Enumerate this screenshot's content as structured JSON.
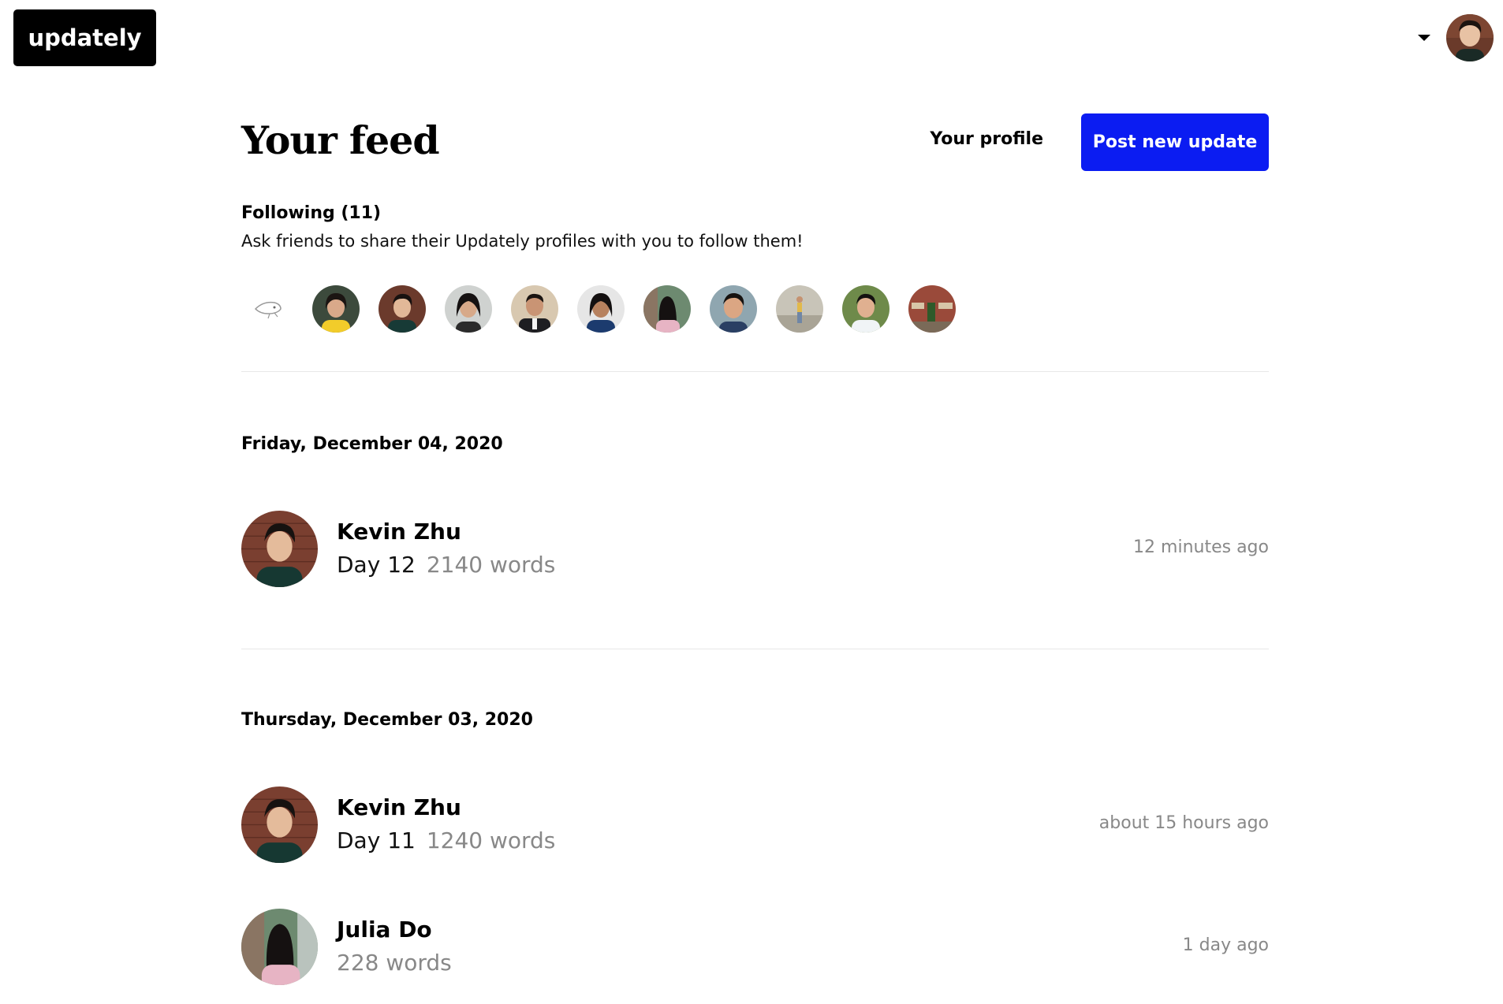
{
  "brand": {
    "logo_text": "updately"
  },
  "account": {
    "menu_icon": "caret-down-icon"
  },
  "header": {
    "title": "Your feed",
    "profile_link": "Your profile",
    "post_button": "Post new update"
  },
  "following": {
    "label": "Following (11)",
    "hint": "Ask friends to share their Updately profiles with you to follow them!",
    "avatars": [
      {
        "name": "sketch-avatar"
      },
      {
        "name": "avatar-yellow-shirt"
      },
      {
        "name": "avatar-brick-wall"
      },
      {
        "name": "avatar-dark-hair"
      },
      {
        "name": "avatar-suit"
      },
      {
        "name": "avatar-scarf"
      },
      {
        "name": "avatar-julia"
      },
      {
        "name": "avatar-smiling"
      },
      {
        "name": "avatar-street"
      },
      {
        "name": "avatar-park"
      },
      {
        "name": "avatar-fire-words"
      }
    ]
  },
  "feed": [
    {
      "date": "Friday, December 04, 2020",
      "updates": [
        {
          "author": "Kevin Zhu",
          "title": "Day 12",
          "words": "2140 words",
          "time": "12 minutes ago"
        }
      ]
    },
    {
      "date": "Thursday, December 03, 2020",
      "updates": [
        {
          "author": "Kevin Zhu",
          "title": "Day 11",
          "words": "1240 words",
          "time": "about 15 hours ago"
        },
        {
          "author": "Julia Do",
          "title": "",
          "words": "228 words",
          "time": "1 day ago"
        }
      ]
    }
  ]
}
